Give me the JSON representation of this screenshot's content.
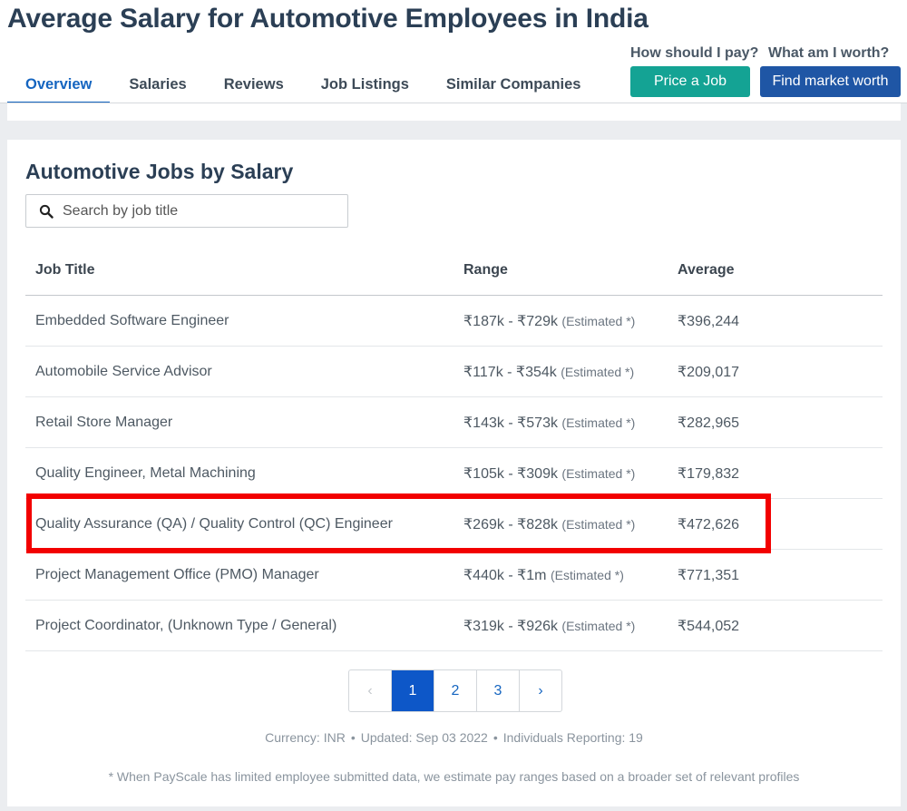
{
  "header": {
    "title": "Average Salary for Automotive Employees in India",
    "tabs": [
      {
        "label": "Overview"
      },
      {
        "label": "Salaries"
      },
      {
        "label": "Reviews"
      },
      {
        "label": "Job Listings"
      },
      {
        "label": "Similar Companies"
      }
    ],
    "active_tab": "Overview",
    "cta": {
      "price_question": "How should I pay?",
      "price_button": "Price a Job",
      "worth_question": "What am I worth?",
      "worth_button": "Find market worth"
    }
  },
  "jobs_section": {
    "title": "Automotive Jobs by Salary",
    "search": {
      "placeholder": "Search by job title",
      "value": ""
    },
    "columns": {
      "job_title": "Job Title",
      "range": "Range",
      "average": "Average"
    },
    "rows": [
      {
        "title": "Embedded Software Engineer",
        "range": "₹187k - ₹729k",
        "note": "(Estimated *)",
        "average": "₹396,244"
      },
      {
        "title": "Automobile Service Advisor",
        "range": "₹117k - ₹354k",
        "note": "(Estimated *)",
        "average": "₹209,017"
      },
      {
        "title": "Retail Store Manager",
        "range": "₹143k - ₹573k",
        "note": "(Estimated *)",
        "average": "₹282,965"
      },
      {
        "title": "Quality Engineer, Metal Machining",
        "range": "₹105k - ₹309k",
        "note": "(Estimated *)",
        "average": "₹179,832"
      },
      {
        "title": "Quality Assurance (QA) / Quality Control (QC) Engineer",
        "range": "₹269k - ₹828k",
        "note": "(Estimated *)",
        "average": "₹472,626"
      },
      {
        "title": "Project Management Office (PMO) Manager",
        "range": "₹440k - ₹1m",
        "note": "(Estimated *)",
        "average": "₹771,351"
      },
      {
        "title": "Project Coordinator, (Unknown Type / General)",
        "range": "₹319k - ₹926k",
        "note": "(Estimated *)",
        "average": "₹544,052"
      }
    ],
    "pagination": {
      "prev": "‹",
      "pages": [
        "1",
        "2",
        "3"
      ],
      "current": "1",
      "next": "›"
    },
    "meta": {
      "currency": "Currency: INR",
      "updated": "Updated: Sep 03 2022",
      "reporting": "Individuals Reporting: 19"
    },
    "footnote": "* When PayScale has limited employee submitted data, we estimate pay ranges based on a broader set of relevant profiles"
  },
  "colors": {
    "title": "#2b3f55",
    "active_tab": "#1565c0",
    "price_button": "#14a394",
    "worth_button": "#1f56a5",
    "current_page": "#0d57c8",
    "highlight": "#f20000"
  }
}
